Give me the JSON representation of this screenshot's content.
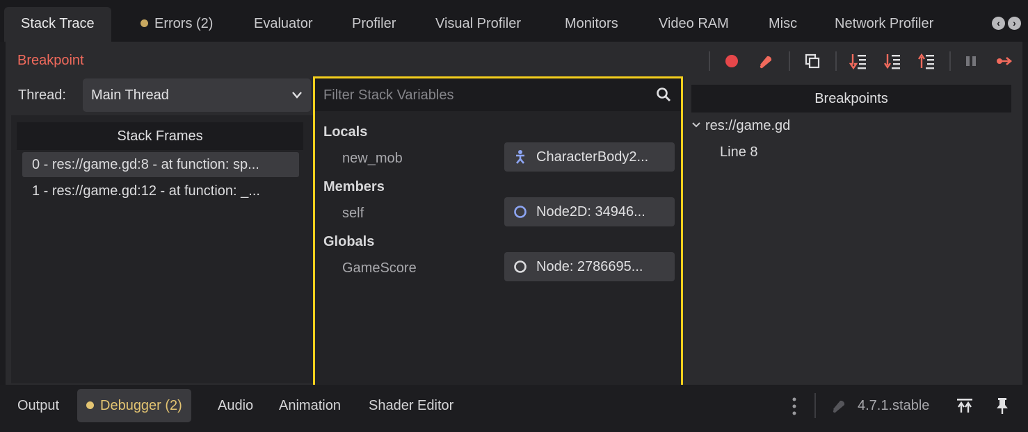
{
  "tabs": [
    {
      "label": "Stack Trace",
      "active": true
    },
    {
      "label": "Errors (2)",
      "dot": true
    },
    {
      "label": "Evaluator"
    },
    {
      "label": "Profiler"
    },
    {
      "label": "Visual Profiler"
    },
    {
      "label": "Monitors"
    },
    {
      "label": "Video RAM"
    },
    {
      "label": "Misc"
    },
    {
      "label": "Network Profiler"
    }
  ],
  "status_label": "Breakpoint",
  "toolbar_icons": [
    "record-breakpoint-icon",
    "clear-breakpoints-icon",
    "copy-icon",
    "step-into-icon",
    "step-over-icon",
    "step-out-icon",
    "pause-icon",
    "continue-icon"
  ],
  "thread": {
    "label": "Thread:",
    "value": "Main Thread"
  },
  "stack_frames": {
    "header": "Stack Frames",
    "rows": [
      "0 - res://game.gd:8 - at function: sp...",
      "1 - res://game.gd:12 - at function: _..."
    ]
  },
  "variables": {
    "filter_placeholder": "Filter Stack Variables",
    "sections": [
      {
        "title": "Locals",
        "name": "new_mob",
        "value": "CharacterBody2...",
        "icon": "character-body-icon"
      },
      {
        "title": "Members",
        "name": "self",
        "value": "Node2D: 34946...",
        "icon": "node2d-icon"
      },
      {
        "title": "Globals",
        "name": "GameScore",
        "value": "Node: 2786695...",
        "icon": "node-icon"
      }
    ]
  },
  "breakpoints": {
    "header": "Breakpoints",
    "file": "res://game.gd",
    "line": "Line 8"
  },
  "bottom_tabs": [
    {
      "label": "Output"
    },
    {
      "label": "Debugger (2)",
      "active": true,
      "dot": true
    },
    {
      "label": "Audio"
    },
    {
      "label": "Animation"
    },
    {
      "label": "Shader Editor"
    }
  ],
  "version": "4.7.1.stable",
  "colors": {
    "accent_red": "#f16a5c",
    "highlight_yellow": "#f4cf1d",
    "warning_dot": "#c8a860",
    "node2d_blue": "#8da5f3",
    "node_gray": "#dcdcde"
  }
}
